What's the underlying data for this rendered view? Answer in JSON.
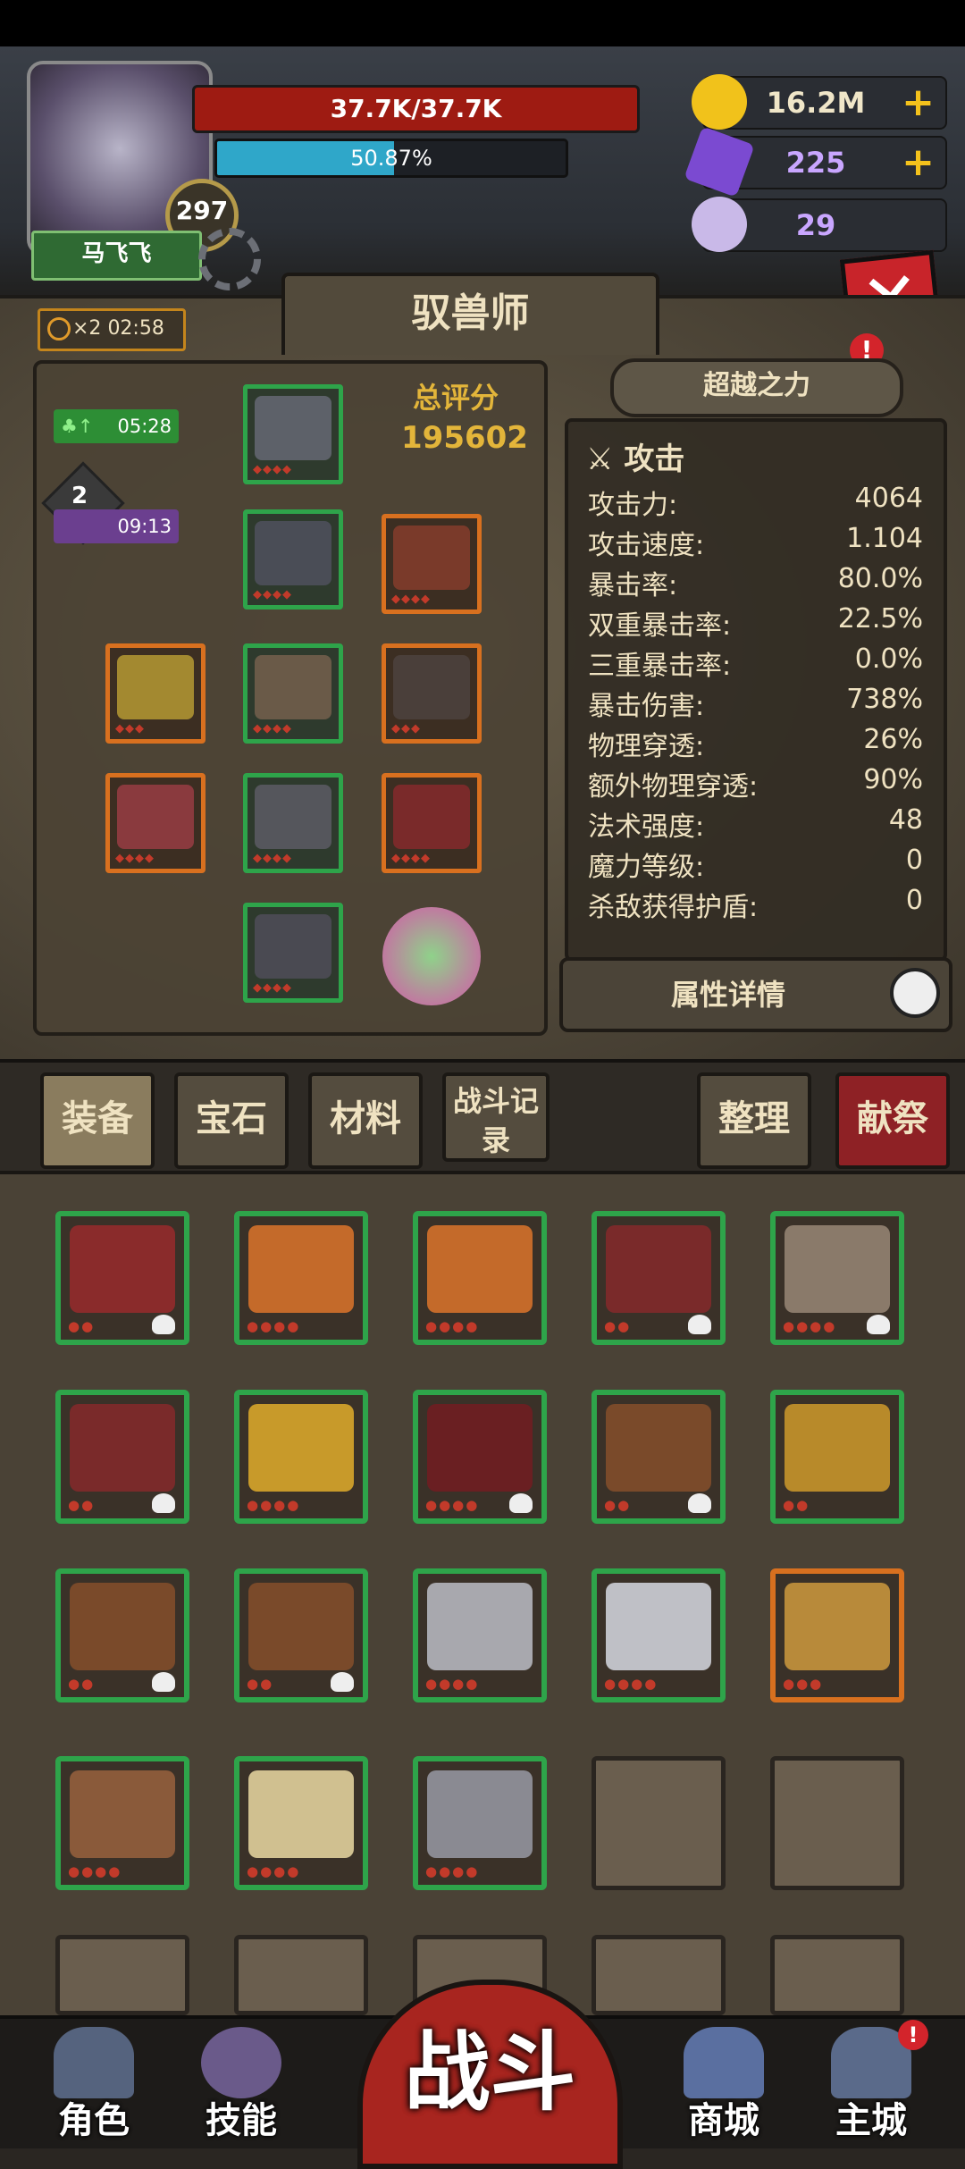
{
  "player": {
    "name": "马飞飞",
    "level": "297",
    "hp": "37.7K/37.7K",
    "xp_text": "50.87%",
    "xp_fraction": 0.5087
  },
  "resources": {
    "gold": "16.2M",
    "crystal": "225",
    "horn": "29",
    "colors": {
      "gold": "#f1c21b",
      "crystal": "#7b4ad1",
      "horn": "#c9b9e8"
    }
  },
  "class_title": "驭兽师",
  "buff_timer": {
    "multiplier": "×2",
    "time": "02:58"
  },
  "timers": [
    {
      "time": "05:28",
      "color": "#2d8e35"
    },
    {
      "time": "09:13",
      "color": "#6b3f8f",
      "badge": "2"
    }
  ],
  "score": {
    "label": "总评分",
    "value": "195602"
  },
  "transcend_button": "超越之力",
  "notice_badge": "!",
  "stats": {
    "header": "攻击",
    "rows": [
      {
        "k": "攻击力:",
        "v": "4064"
      },
      {
        "k": "攻击速度:",
        "v": "1.104"
      },
      {
        "k": "暴击率:",
        "v": "80.0%"
      },
      {
        "k": "双重暴击率:",
        "v": "22.5%"
      },
      {
        "k": "三重暴击率:",
        "v": "0.0%"
      },
      {
        "k": "暴击伤害:",
        "v": "738%"
      },
      {
        "k": "物理穿透:",
        "v": "26%"
      },
      {
        "k": "额外物理穿透:",
        "v": "90%"
      },
      {
        "k": "法术强度:",
        "v": "48"
      },
      {
        "k": "魔力等级:",
        "v": "0"
      },
      {
        "k": "杀敌获得护盾:",
        "v": "0"
      }
    ]
  },
  "detail_button": "属性详情",
  "tabs": {
    "equip": "装备",
    "gem": "宝石",
    "material": "材料",
    "battle_log": "战斗记录",
    "sort": "整理",
    "sacrifice": "献祭"
  },
  "nav": {
    "character": "角色",
    "skill": "技能",
    "fight": "战斗",
    "shop": "商城",
    "main_city": "主城"
  }
}
